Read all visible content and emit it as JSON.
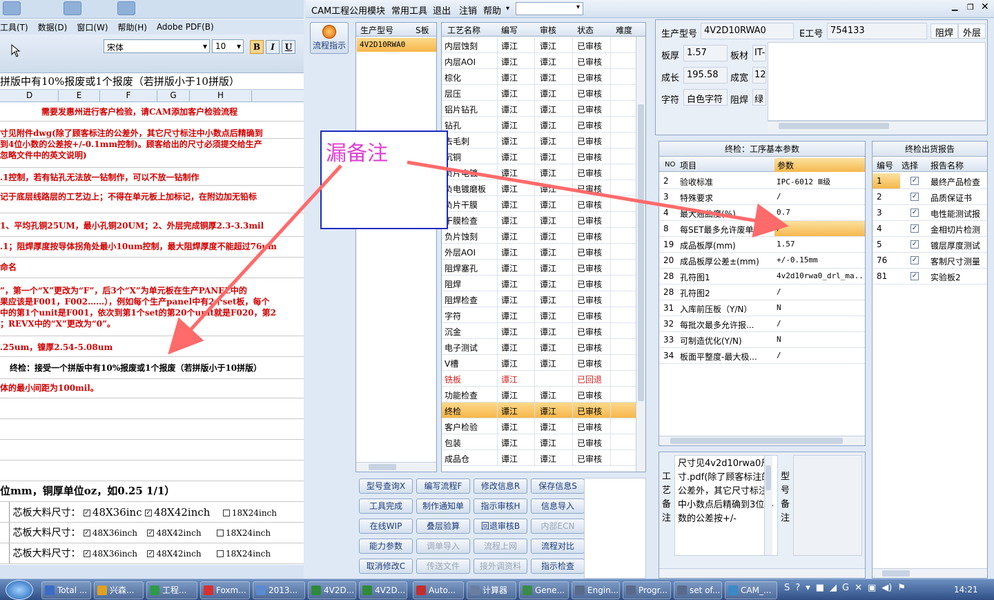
{
  "excel": {
    "menu": [
      "工具(T)",
      "数据(D)",
      "窗口(W)",
      "帮助(H)",
      "Adobe PDF(B)"
    ],
    "font_name": "宋体",
    "font_size": "10",
    "formula_text": "拼版中有10%报废或1个报废（若拼版小于10拼版）",
    "columns": [
      "D",
      "E",
      "F",
      "G",
      "H"
    ],
    "rows": [
      "需要发惠州进行客户检验，请CAM添加客户检验流程",
      "寸见附件dwg(除了顾客标注的公差外，其它尺寸标注中小数点后精确到",
      "到4位小数的公差按+/-0.1mm控制)。顾客给出的尺寸必须提交给生产",
      "忽略文件中的英文说明)",
      ".1控制，若有钻孔无法放一钻制作，可以不放一钻制作",
      "记于底层线路层的工艺边上；不得在单元板上加标记，在附边加无铅标",
      "1、平均孔铜25UM，最小孔铜20UM；2、外层完成铜厚2.3-3.3mil",
      ".1；阻焊厚度按导体拐角处最小10um控制，最大阻焊厚度不能超过76um",
      "命名",
      "”，第一个“X”更改为“F”，后3个“X”为单元板在生产PANEL中的",
      "果应该是F001，F002……），例如每个生产panel中有2个set板，每个",
      "中的第1个unit是F001，依次到第1个set的第20个unit就是F020，第2",
      "；REVX中的“X”更改为“0”。",
      ".25um，镍厚2.54-5.08um",
      "终检：接受一个拼版中有10%报废或1个报废（若拼版小于10拼版）",
      "体的最小间距为100mil。",
      "位mm，铜厚单位oz，如0.25 1/1）"
    ],
    "core_label": "芯板大料尺寸：",
    "core_rows": [
      {
        "a": "48X36inc",
        "b": "48X42inch",
        "c": "18X24inch"
      },
      {
        "a": "48X36inch",
        "b": "48X42inch",
        "c": "18X24inch"
      },
      {
        "a": "48X36inch",
        "b": "48X42inch",
        "c": "18X24inch"
      }
    ]
  },
  "cam": {
    "menu": [
      "CAM工程",
      "公用模块",
      "常用工具",
      "退出",
      "注销",
      "帮助"
    ],
    "flow_button": "流程指示",
    "model_table": {
      "headers": [
        "生产型号",
        "S板"
      ],
      "rows": [
        "4V2D10RWA0"
      ]
    },
    "process_table": {
      "headers": [
        "工艺名称",
        "编写",
        "审核",
        "状态",
        "难度"
      ],
      "rows": [
        [
          "内层蚀刻",
          "谭江",
          "谭江",
          "已审核"
        ],
        [
          "内层AOI",
          "谭江",
          "谭江",
          "已审核"
        ],
        [
          "棕化",
          "谭江",
          "谭江",
          "已审核"
        ],
        [
          "层压",
          "谭江",
          "谭江",
          "已审核"
        ],
        [
          "铝片钻孔",
          "谭江",
          "谭江",
          "已审核"
        ],
        [
          "钻孔",
          "谭江",
          "谭江",
          "已审核"
        ],
        [
          "去毛刺",
          "谭江",
          "谭江",
          "已审核"
        ],
        [
          "沉铜",
          "谭江",
          "谭江",
          "已审核"
        ],
        [
          "负片电镀",
          "谭江",
          "谭江",
          "已审核"
        ],
        [
          "负电镀磨板",
          "谭江",
          "谭江",
          "已审核"
        ],
        [
          "负片干膜",
          "谭江",
          "谭江",
          "已审核"
        ],
        [
          "干膜检查",
          "谭江",
          "谭江",
          "已审核"
        ],
        [
          "负片蚀刻",
          "谭江",
          "谭江",
          "已审核"
        ],
        [
          "外层AOI",
          "谭江",
          "谭江",
          "已审核"
        ],
        [
          "阻焊塞孔",
          "谭江",
          "谭江",
          "已审核"
        ],
        [
          "阻焊",
          "谭江",
          "谭江",
          "已审核"
        ],
        [
          "阻焊检查",
          "谭江",
          "谭江",
          "已审核"
        ],
        [
          "字符",
          "谭江",
          "谭江",
          "已审核"
        ],
        [
          "沉金",
          "谭江",
          "谭江",
          "已审核"
        ],
        [
          "电子测试",
          "谭江",
          "谭江",
          "已审核"
        ],
        [
          "V槽",
          "谭江",
          "谭江",
          "已审核"
        ],
        [
          "铣板",
          "谭江",
          "",
          "已回退"
        ],
        [
          "功能检查",
          "谭江",
          "谭江",
          "已审核"
        ],
        [
          "终检",
          "谭江",
          "谭江",
          "已审核"
        ],
        [
          "客户检验",
          "谭江",
          "谭江",
          "已审核"
        ],
        [
          "包装",
          "谭江",
          "谭江",
          "已审核"
        ],
        [
          "成品仓",
          "谭江",
          "谭江",
          "已审核"
        ]
      ]
    },
    "info": {
      "model_label": "生产型号",
      "model_value": "4V2D10RWA0",
      "eng_label": "E工号",
      "eng_value": "754133",
      "tab1": "阻焊",
      "tab2": "外层",
      "thick_label": "板厚",
      "thick_value": "1.57",
      "mat_label": "板材",
      "mat_value": "IT-",
      "len_label": "成长",
      "len_value": "195.58",
      "wid_label": "成宽",
      "wid_value": "12",
      "char_label": "字符",
      "char_value": "白色字符",
      "mask_label": "阻焊",
      "mask_value": "绿"
    },
    "params": {
      "title": "终检：工序基本参数",
      "headers": [
        "NO",
        "项目",
        "参数"
      ],
      "rows": [
        [
          "2",
          "验收标准",
          "IPC-6012 Ⅲ级"
        ],
        [
          "3",
          "特殊要求",
          "/"
        ],
        [
          "4",
          "最大翘曲度(%)",
          "0.7"
        ],
        [
          "8",
          "每SET最多允许废单元",
          "/"
        ],
        [
          "19",
          "成品板厚(mm)",
          "1.57"
        ],
        [
          "20",
          "成品板厚公差±(mm)",
          "+/-0.15mm"
        ],
        [
          "28",
          "孔符图1",
          "4v2d10rwa0_drl_ma..."
        ],
        [
          "28",
          "孔符图2",
          "/"
        ],
        [
          "31",
          "入库前压板（Y/N）",
          "N"
        ],
        [
          "32",
          "每批次最多允许报...",
          "/"
        ],
        [
          "33",
          "可制造优化(Y/N)",
          "N"
        ],
        [
          "34",
          "板面平整度-最大极...",
          "/"
        ]
      ]
    },
    "reports": {
      "title": "终检出货报告",
      "headers": [
        "编号",
        "选择",
        "报告名称"
      ],
      "rows": [
        [
          "1",
          "最终产品检查"
        ],
        [
          "2",
          "品质保证书"
        ],
        [
          "3",
          "电性能测试报"
        ],
        [
          "4",
          "金相切片检测"
        ],
        [
          "5",
          "镀层厚度测试"
        ],
        [
          "76",
          "客制尺寸测量"
        ],
        [
          "81",
          "实验板2"
        ]
      ]
    },
    "buttons": [
      [
        "型号查询X",
        "编写流程F",
        "修改信息R",
        "保存信息S"
      ],
      [
        "工具完成",
        "制作通知单",
        "指示审核H",
        "信息导入"
      ],
      [
        "在线WIP",
        "叠层验算",
        "回退审核B",
        "内部ECN"
      ],
      [
        "能力参数",
        "调单导入",
        "流程上网",
        "流程对比"
      ],
      [
        "取消修改C",
        "传送文件",
        "接外调资料",
        "指示检查"
      ]
    ],
    "remark_label": "工艺备注",
    "remark_text": "尺寸见4v2d10rwa0尺寸.pdf(除了顾客标注的公差外，其它尺寸标注中小数点后精确到3位小数的公差按+/-",
    "model_remark_label": "型号备注"
  },
  "annotation": {
    "text": "漏备注"
  },
  "taskbar": {
    "items": [
      "Total ...",
      "兴森...",
      "工程...",
      "Foxm...",
      "2013...",
      "4V2D...",
      "4V2D...",
      "Auto...",
      "计算器",
      "Gene...",
      "Engin...",
      "Progr...",
      "set of...",
      "CAM_..."
    ],
    "clock": "14:21"
  }
}
